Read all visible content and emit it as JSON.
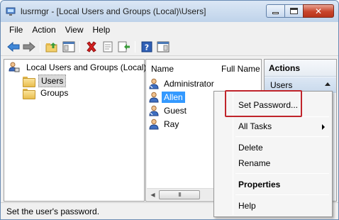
{
  "window": {
    "title": "lusrmgr - [Local Users and Groups (Local)\\Users]",
    "minimize_icon": "minimize-icon",
    "maximize_icon": "maximize-icon",
    "close_icon": "close-icon",
    "close_glyph": "✕"
  },
  "menubar": {
    "items": [
      "File",
      "Action",
      "View",
      "Help"
    ]
  },
  "toolbar": {
    "buttons": [
      "back-icon",
      "forward-icon",
      "up-folder-icon",
      "show-hide-tree-icon",
      "delete-icon",
      "properties-icon",
      "export-list-icon",
      "help-icon",
      "show-hide-action-pane-icon"
    ]
  },
  "tree": {
    "root_label": "Local Users and Groups (Local)",
    "children": [
      {
        "label": "Users",
        "selected": true
      },
      {
        "label": "Groups",
        "selected": false
      }
    ]
  },
  "list": {
    "columns": [
      "Name",
      "Full Name"
    ],
    "rows": [
      {
        "name": "Administrator",
        "selected": false
      },
      {
        "name": "Allen",
        "selected": true
      },
      {
        "name": "Guest",
        "selected": false
      },
      {
        "name": "Ray",
        "selected": false
      }
    ],
    "scroll_thumb_grip": "III"
  },
  "actions": {
    "header": "Actions",
    "section": "Users"
  },
  "context_menu": {
    "items": [
      {
        "label": "Set Password...",
        "bold": false
      },
      {
        "label": "All Tasks",
        "bold": false,
        "submenu": true
      },
      {
        "label": "Delete",
        "bold": false
      },
      {
        "label": "Rename",
        "bold": false
      },
      {
        "label": "Properties",
        "bold": true
      },
      {
        "label": "Help",
        "bold": false
      }
    ]
  },
  "status": {
    "text": "Set the user's password."
  },
  "colors": {
    "selection": "#3399ff",
    "highlight_box": "#c0242b",
    "close_button": "#c8442b"
  }
}
